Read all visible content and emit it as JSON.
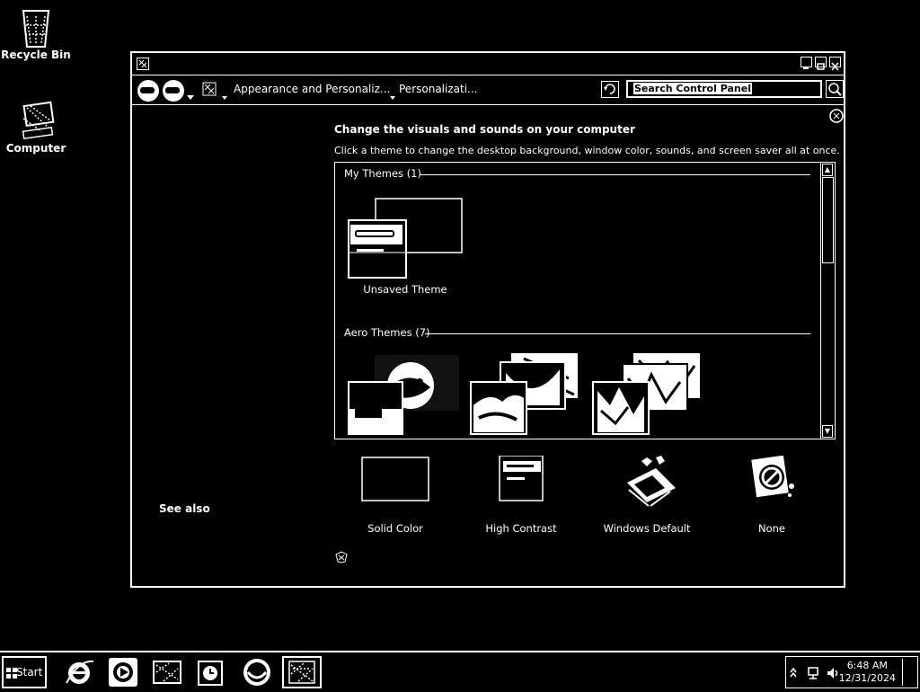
{
  "desktop": {
    "icons": [
      {
        "label": "Recycle Bin",
        "icon": "recycle-bin-icon"
      },
      {
        "label": "Computer",
        "icon": "computer-icon"
      }
    ]
  },
  "window": {
    "address": {
      "crumbs": [
        "Appearance and Personaliz...",
        "Personalizati..."
      ]
    },
    "search": {
      "placeholder": "Search Control Panel"
    },
    "main": {
      "heading": "Change the visuals and sounds on your computer",
      "subheading": "Click a theme to change the desktop background, window color, sounds, and screen saver all at once.",
      "groups": [
        {
          "title": "My Themes (1)",
          "themes": [
            "Unsaved Theme"
          ]
        },
        {
          "title": "Aero Themes (7)"
        }
      ],
      "basic_themes": [
        "Solid Color",
        "High Contrast",
        "Windows Default",
        "None"
      ]
    },
    "sidebar": {
      "see_also": "See also"
    }
  },
  "taskbar": {
    "start_label": "Start",
    "clock": {
      "time": "6:48 AM",
      "date": "12/31/2024"
    }
  }
}
